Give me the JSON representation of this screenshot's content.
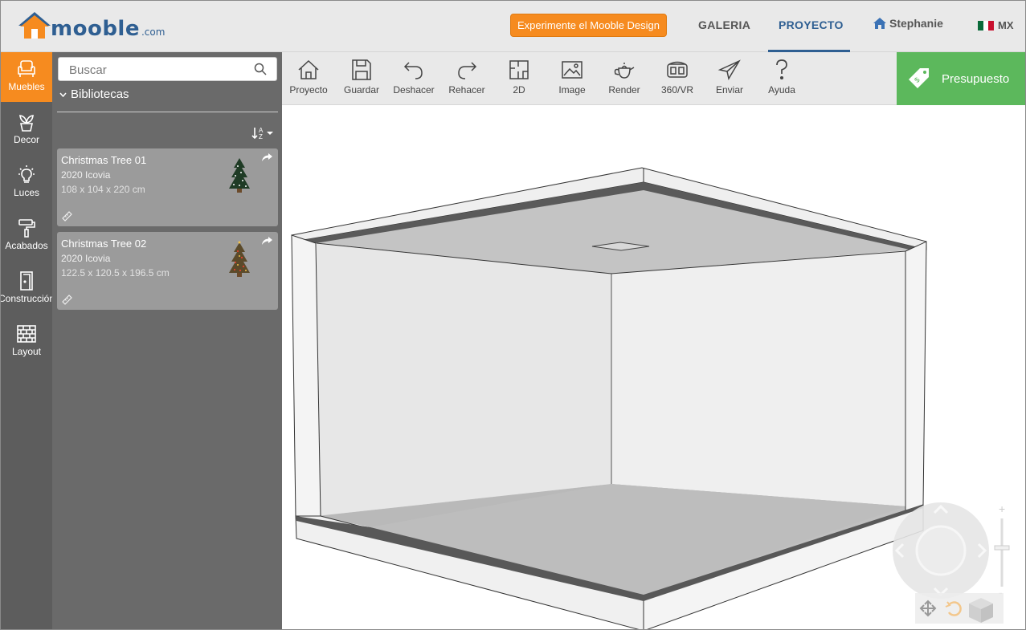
{
  "brand": {
    "name": "mooble",
    "suffix": ".com",
    "color": "#2f5f92"
  },
  "header": {
    "cta_label": "Experimente el Mooble Design",
    "nav": {
      "galeria": "GALERIA",
      "proyecto": "PROYECTO"
    },
    "active_nav": "PROYECTO",
    "user_name": "Stephanie",
    "country": "MX"
  },
  "rail": {
    "items": [
      {
        "label": "Muebles",
        "icon": "armchair-icon",
        "active": true
      },
      {
        "label": "Decor",
        "icon": "plant-icon"
      },
      {
        "label": "Luces",
        "icon": "lightbulb-icon"
      },
      {
        "label": "Acabados",
        "icon": "paint-roller-icon"
      },
      {
        "label": "Construcción",
        "icon": "door-icon"
      },
      {
        "label": "Layout",
        "icon": "brick-wall-icon"
      }
    ]
  },
  "library": {
    "search_placeholder": "Buscar",
    "section_label": "Bibliotecas",
    "items": [
      {
        "name": "Christmas Tree 01",
        "brand": "2020 Icovia",
        "dimensions": "108 x 104 x 220 cm"
      },
      {
        "name": "Christmas Tree 02",
        "brand": "2020 Icovia",
        "dimensions": "122.5 x 120.5 x 196.5 cm"
      }
    ]
  },
  "toolbar": {
    "items": [
      {
        "label": "Proyecto",
        "icon": "house-icon"
      },
      {
        "label": "Guardar",
        "icon": "floppy-icon"
      },
      {
        "label": "Deshacer",
        "icon": "undo-icon"
      },
      {
        "label": "Rehacer",
        "icon": "redo-icon"
      },
      {
        "label": "2D",
        "icon": "floorplan-icon"
      },
      {
        "label": "Image",
        "icon": "image-icon"
      },
      {
        "label": "Render",
        "icon": "teapot-icon"
      },
      {
        "label": "360/VR",
        "icon": "vr-headset-icon"
      },
      {
        "label": "Enviar",
        "icon": "paper-plane-icon"
      },
      {
        "label": "Ayuda",
        "icon": "question-icon"
      }
    ],
    "budget_label": "Presupuesto"
  },
  "colors": {
    "accent": "#f68b1f",
    "budget": "#5cb85c",
    "rail": "#5d5d5d",
    "panel": "#6a6a6a"
  }
}
